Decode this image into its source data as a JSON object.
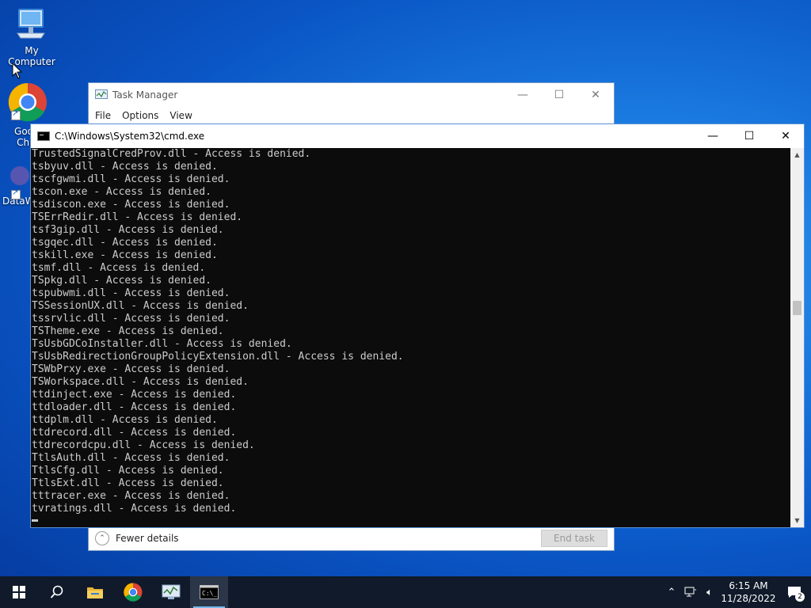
{
  "desktop": {
    "icons": [
      {
        "label": "My Computer",
        "icon": "computer-icon"
      },
      {
        "label": "Goo Chr",
        "icon": "chrome-icon"
      },
      {
        "label": "DataW",
        "icon": "datawrapper-icon"
      }
    ]
  },
  "task_manager": {
    "title": "Task Manager",
    "menu": [
      "File",
      "Options",
      "View"
    ],
    "fewer_details": "Fewer details",
    "end_task": "End task",
    "controls": {
      "minimize": "—",
      "maximize": "☐",
      "close": "✕"
    }
  },
  "cmd": {
    "title": "C:\\Windows\\System32\\cmd.exe",
    "controls": {
      "minimize": "—",
      "maximize": "☐",
      "close": "✕"
    },
    "lines": [
      "TrustedSignalCredProv.dll - Access is denied.",
      "tsbyuv.dll - Access is denied.",
      "tscfgwmi.dll - Access is denied.",
      "tscon.exe - Access is denied.",
      "tsdiscon.exe - Access is denied.",
      "TSErrRedir.dll - Access is denied.",
      "tsf3gip.dll - Access is denied.",
      "tsgqec.dll - Access is denied.",
      "tskill.exe - Access is denied.",
      "tsmf.dll - Access is denied.",
      "TSpkg.dll - Access is denied.",
      "tspubwmi.dll - Access is denied.",
      "TSSessionUX.dll - Access is denied.",
      "tssrvlic.dll - Access is denied.",
      "TSTheme.exe - Access is denied.",
      "TsUsbGDCoInstaller.dll - Access is denied.",
      "TsUsbRedirectionGroupPolicyExtension.dll - Access is denied.",
      "TSWbPrxy.exe - Access is denied.",
      "TSWorkspace.dll - Access is denied.",
      "ttdinject.exe - Access is denied.",
      "ttdloader.dll - Access is denied.",
      "ttdplm.dll - Access is denied.",
      "ttdrecord.dll - Access is denied.",
      "ttdrecordcpu.dll - Access is denied.",
      "TtlsAuth.dll - Access is denied.",
      "TtlsCfg.dll - Access is denied.",
      "TtlsExt.dll - Access is denied.",
      "tttracer.exe - Access is denied.",
      "tvratings.dll - Access is denied."
    ]
  },
  "taskbar": {
    "items": [
      "start-icon",
      "search-icon",
      "file-explorer-icon",
      "chrome-icon",
      "task-manager-icon",
      "cmd-icon"
    ],
    "time": "6:15 AM",
    "date": "11/28/2022",
    "notification_count": "2"
  },
  "colors": {
    "cmd_background": "#0c0c0c",
    "cmd_text": "#cccccc",
    "taskbar": "#101a2a",
    "desktop_blue": "#0a56c6"
  }
}
